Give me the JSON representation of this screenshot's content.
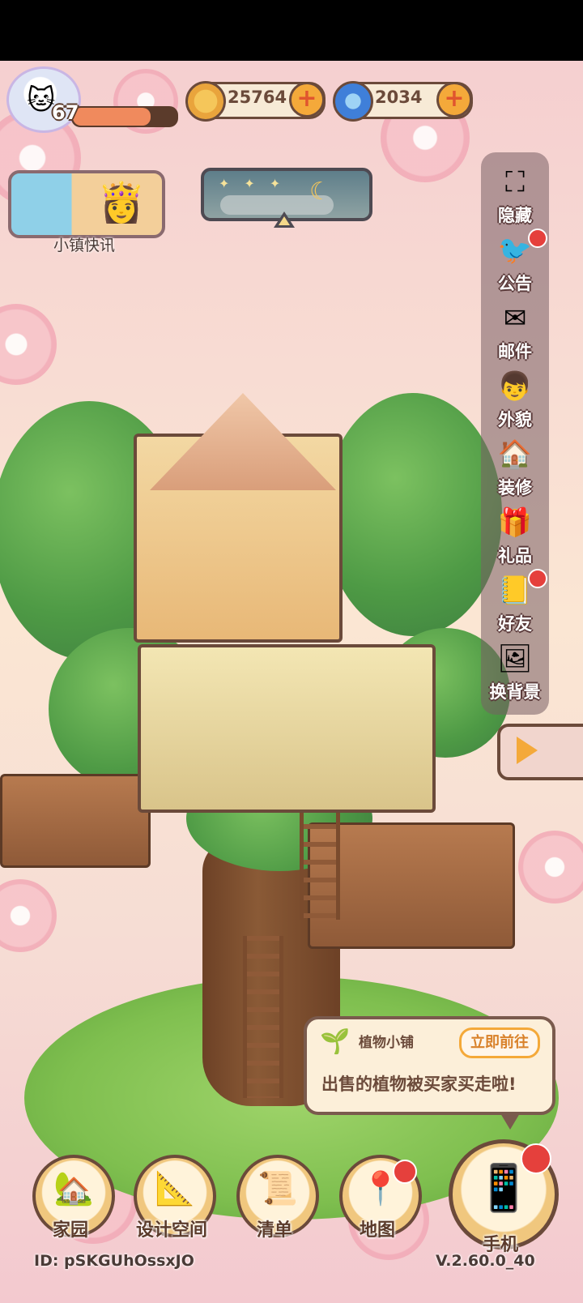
{
  "player": {
    "level": "67",
    "level_progress": 0.75
  },
  "currencies": [
    {
      "name": "coin",
      "value": "25764"
    },
    {
      "name": "gem",
      "value": "2034"
    }
  ],
  "news": {
    "label": "小镇快讯"
  },
  "side_menu": [
    {
      "label": "隐藏",
      "icon": "hide-frame-icon",
      "badge": false
    },
    {
      "label": "公告",
      "icon": "announcement-bird-icon",
      "badge": true
    },
    {
      "label": "邮件",
      "icon": "mail-icon",
      "badge": false
    },
    {
      "label": "外貌",
      "icon": "avatar-face-icon",
      "badge": false
    },
    {
      "label": "装修",
      "icon": "house-wrench-icon",
      "badge": false
    },
    {
      "label": "礼品",
      "icon": "gift-icon",
      "badge": false
    },
    {
      "label": "好友",
      "icon": "friends-book-icon",
      "badge": true
    },
    {
      "label": "换背景",
      "icon": "background-card-icon",
      "badge": false
    }
  ],
  "notice": {
    "title": "植物小铺",
    "action": "立即前往",
    "message": "出售的植物被买家买走啦!"
  },
  "bottom_nav": [
    {
      "label": "家园",
      "icon": "home-icon",
      "badge": false
    },
    {
      "label": "设计空间",
      "icon": "design-ruler-icon",
      "badge": false
    },
    {
      "label": "清单",
      "icon": "list-quill-icon",
      "badge": false
    },
    {
      "label": "地图",
      "icon": "map-pin-icon",
      "badge": true
    }
  ],
  "phone": {
    "label": "手机",
    "badge": true
  },
  "footer": {
    "id": "ID: pSKGUhOssxJO",
    "version": "V.2.60.0_40"
  },
  "colors": {
    "accent": "#f4a93a",
    "outline": "#6b4a3a",
    "badge": "#e5403c"
  }
}
